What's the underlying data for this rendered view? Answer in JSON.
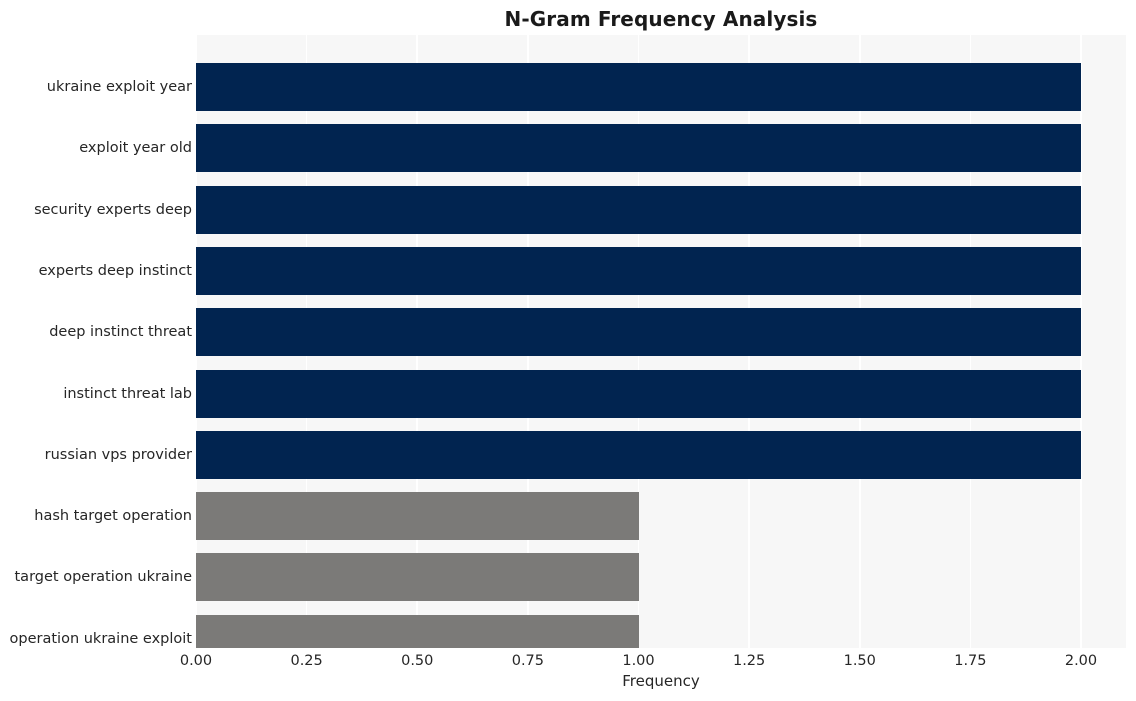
{
  "chart_data": {
    "type": "bar",
    "orientation": "horizontal",
    "title": "N-Gram Frequency Analysis",
    "xlabel": "Frequency",
    "ylabel": "",
    "categories": [
      "ukraine exploit year",
      "exploit year old",
      "security experts deep",
      "experts deep instinct",
      "deep instinct threat",
      "instinct threat lab",
      "russian vps provider",
      "hash target operation",
      "target operation ukraine",
      "operation ukraine exploit"
    ],
    "values": [
      2,
      2,
      2,
      2,
      2,
      2,
      2,
      1,
      1,
      1
    ],
    "bar_colors": [
      "#012450",
      "#012450",
      "#012450",
      "#012450",
      "#012450",
      "#012450",
      "#012450",
      "#7b7a78",
      "#7b7a78",
      "#7b7a78"
    ],
    "xlim": [
      0.0,
      2.1
    ],
    "xticks": [
      0.0,
      0.25,
      0.5,
      0.75,
      1.0,
      1.25,
      1.5,
      1.75,
      2.0
    ],
    "xtick_labels": [
      "0.00",
      "0.25",
      "0.50",
      "0.75",
      "1.00",
      "1.25",
      "1.50",
      "1.75",
      "2.00"
    ],
    "grid": true,
    "grid_axis": "x",
    "grid_color": "#ffffff",
    "legend": null,
    "plot_background": "#f7f7f7",
    "figure_background": "#ffffff",
    "text_color": "#262626"
  }
}
